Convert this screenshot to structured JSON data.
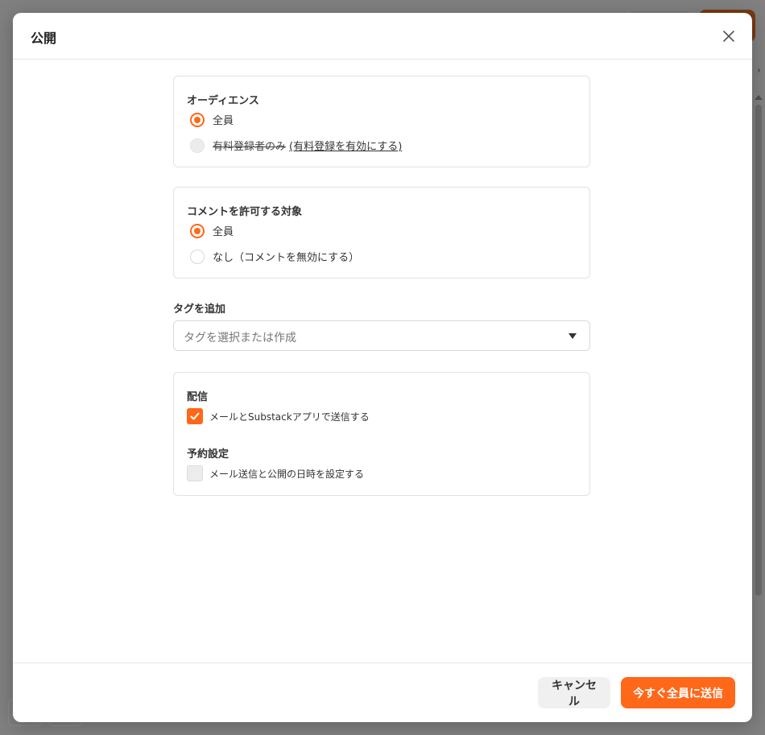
{
  "modal": {
    "title": "公開",
    "close_label": "×"
  },
  "audience": {
    "label": "オーディエンス",
    "options": [
      {
        "label": "全員",
        "selected": true
      },
      {
        "label": "有料登録者のみ",
        "link": "(有料登録を有効にする)",
        "disabled": true,
        "selected": false
      }
    ]
  },
  "comments": {
    "label": "コメントを許可する対象",
    "options": [
      {
        "label": "全員",
        "selected": true
      },
      {
        "label": "なし（コメントを無効にする）",
        "selected": false
      }
    ]
  },
  "tags": {
    "label": "タグを追加",
    "placeholder": "タグを選択または作成"
  },
  "delivery": {
    "label": "配信",
    "option": {
      "label": "メールとSubstackアプリで送信する",
      "checked": true
    },
    "schedule_label": "予約設定",
    "schedule_option": {
      "label": "メール送信と公開の日時を設定する",
      "checked": false
    }
  },
  "footer": {
    "cancel_label": "キャンセル",
    "send_label": "今すぐ全員に送信"
  },
  "colors": {
    "accent": "#ff6719",
    "overlay": "#808080"
  }
}
